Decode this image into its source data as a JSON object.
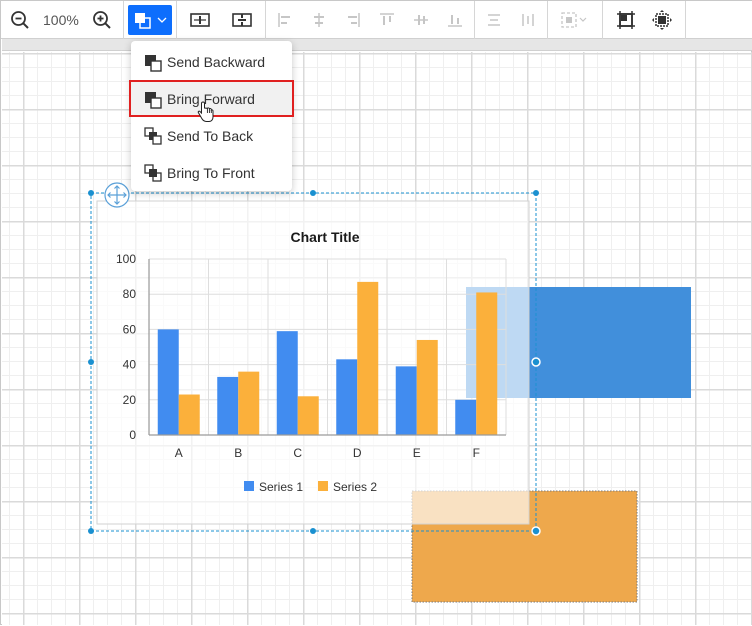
{
  "toolbar": {
    "zoom_out": "zoom-out",
    "zoom_level": "100%",
    "zoom_in": "zoom-in",
    "order_button_active": true,
    "accent_color": "#0d6efd"
  },
  "order_menu": {
    "items": [
      {
        "label": "Send Backward",
        "icon": "send-backward-icon"
      },
      {
        "label": "Bring Forward",
        "icon": "bring-forward-icon",
        "hovered": true
      },
      {
        "label": "Send To Back",
        "icon": "send-to-back-icon"
      },
      {
        "label": "Bring To Front",
        "icon": "bring-to-front-icon"
      }
    ]
  },
  "shapes": {
    "blue_rect_color": "#418fdb",
    "orange_rect_color": "#eea84c",
    "selection_color": "#1a90d0"
  },
  "chart_data": {
    "type": "bar",
    "title": "Chart Title",
    "categories": [
      "A",
      "B",
      "C",
      "D",
      "E",
      "F"
    ],
    "series": [
      {
        "name": "Series 1",
        "color": "#418cf0",
        "values": [
          60,
          33,
          59,
          43,
          39,
          20
        ]
      },
      {
        "name": "Series 2",
        "color": "#fbb03b",
        "values": [
          23,
          36,
          22,
          87,
          54,
          81
        ]
      }
    ],
    "xlabel": "",
    "ylabel": "",
    "ylim": [
      0,
      100
    ],
    "yticks": [
      0,
      20,
      40,
      60,
      80,
      100
    ],
    "grid": true,
    "legend": "bottom"
  }
}
